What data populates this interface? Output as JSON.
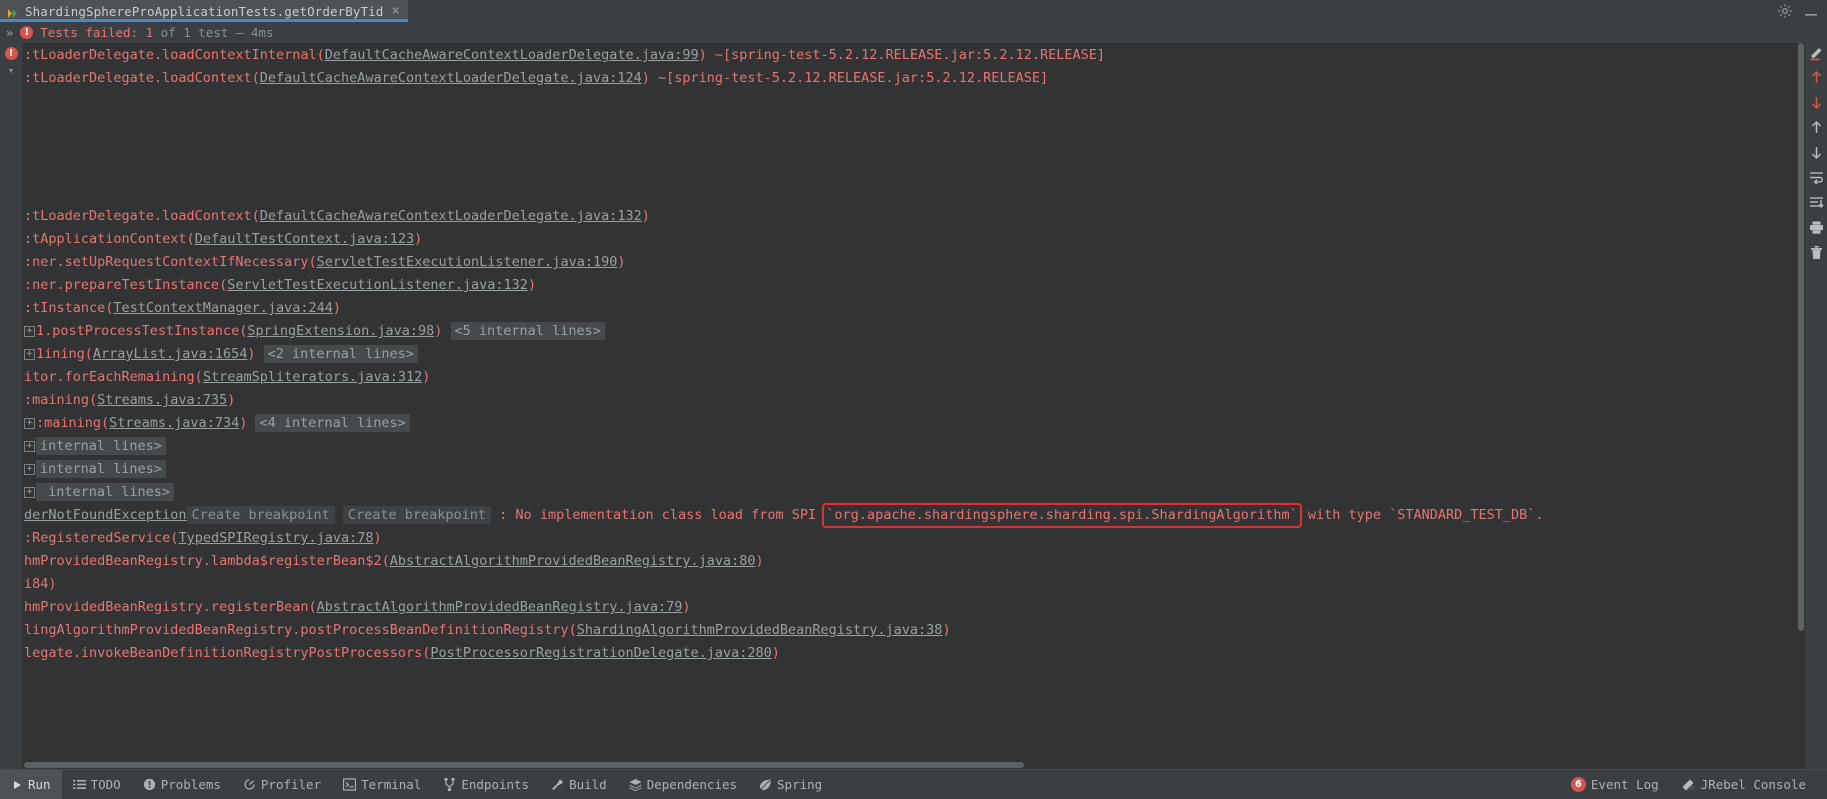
{
  "tab": {
    "label": "ShardingSphereProApplicationTests.getOrderByTid",
    "close": "×",
    "run_icon": "run-play-icon"
  },
  "titlebar_right": {
    "settings_icon": "gear-icon",
    "minimize_icon": "minimize-icon"
  },
  "status": {
    "chevron": "»",
    "error_icon": "error-exclamation-icon",
    "failed_label": "Tests failed: ",
    "failed_count": "1",
    "of_label": " of 1 test – 4ms"
  },
  "gutter": {
    "error_icon": "error-exclamation-icon",
    "collapse_icon": "chevron-down-icon"
  },
  "console": {
    "lines": [
      {
        "type": "trace",
        "fold": false,
        "segs": [
          {
            "t": "red",
            "v": ":tLoaderDelegate.loadContextInternal("
          },
          {
            "t": "link",
            "v": "DefaultCacheAwareContextLoaderDelegate.java:99"
          },
          {
            "t": "red",
            "v": ") ~[spring-test-5.2.12.RELEASE.jar:5.2.12.RELEASE]"
          }
        ]
      },
      {
        "type": "trace",
        "fold": false,
        "segs": [
          {
            "t": "red",
            "v": ":tLoaderDelegate.loadContext("
          },
          {
            "t": "link",
            "v": "DefaultCacheAwareContextLoaderDelegate.java:124"
          },
          {
            "t": "red",
            "v": ") ~[spring-test-5.2.12.RELEASE.jar:5.2.12.RELEASE]"
          }
        ]
      },
      {
        "type": "blank",
        "fold": false,
        "segs": []
      },
      {
        "type": "blank",
        "fold": false,
        "segs": []
      },
      {
        "type": "blank",
        "fold": false,
        "segs": []
      },
      {
        "type": "blank",
        "fold": false,
        "segs": []
      },
      {
        "type": "blank",
        "fold": false,
        "segs": []
      },
      {
        "type": "trace",
        "fold": false,
        "segs": [
          {
            "t": "red",
            "v": ":tLoaderDelegate.loadContext("
          },
          {
            "t": "link",
            "v": "DefaultCacheAwareContextLoaderDelegate.java:132"
          },
          {
            "t": "red",
            "v": ")"
          }
        ]
      },
      {
        "type": "trace",
        "fold": false,
        "segs": [
          {
            "t": "red",
            "v": ":tApplicationContext("
          },
          {
            "t": "link",
            "v": "DefaultTestContext.java:123"
          },
          {
            "t": "red",
            "v": ")"
          }
        ]
      },
      {
        "type": "trace",
        "fold": false,
        "segs": [
          {
            "t": "red",
            "v": ":ner.setUpRequestContextIfNecessary("
          },
          {
            "t": "link",
            "v": "ServletTestExecutionListener.java:190"
          },
          {
            "t": "red",
            "v": ")"
          }
        ]
      },
      {
        "type": "trace",
        "fold": false,
        "segs": [
          {
            "t": "red",
            "v": ":ner.prepareTestInstance("
          },
          {
            "t": "link",
            "v": "ServletTestExecutionListener.java:132"
          },
          {
            "t": "red",
            "v": ")"
          }
        ]
      },
      {
        "type": "trace",
        "fold": false,
        "segs": [
          {
            "t": "red",
            "v": ":tInstance("
          },
          {
            "t": "link",
            "v": "TestContextManager.java:244"
          },
          {
            "t": "red",
            "v": ")"
          }
        ]
      },
      {
        "type": "trace",
        "fold": true,
        "segs": [
          {
            "t": "red",
            "v": "1.postProcessTestInstance("
          },
          {
            "t": "link",
            "v": "SpringExtension.java:98"
          },
          {
            "t": "red",
            "v": ") "
          },
          {
            "t": "badge",
            "v": "<5 internal lines>"
          }
        ]
      },
      {
        "type": "trace",
        "fold": true,
        "segs": [
          {
            "t": "red",
            "v": "1ining("
          },
          {
            "t": "link",
            "v": "ArrayList.java:1654"
          },
          {
            "t": "red",
            "v": ") "
          },
          {
            "t": "badge",
            "v": "<2 internal lines>"
          }
        ]
      },
      {
        "type": "trace",
        "fold": false,
        "segs": [
          {
            "t": "red",
            "v": "itor.forEachRemaining("
          },
          {
            "t": "link",
            "v": "StreamSpliterators.java:312"
          },
          {
            "t": "red",
            "v": ")"
          }
        ]
      },
      {
        "type": "trace",
        "fold": false,
        "segs": [
          {
            "t": "red",
            "v": ":maining("
          },
          {
            "t": "link",
            "v": "Streams.java:735"
          },
          {
            "t": "red",
            "v": ")"
          }
        ]
      },
      {
        "type": "trace",
        "fold": true,
        "segs": [
          {
            "t": "red",
            "v": ":maining("
          },
          {
            "t": "link",
            "v": "Streams.java:734"
          },
          {
            "t": "red",
            "v": ") "
          },
          {
            "t": "badge",
            "v": "<4 internal lines>"
          }
        ]
      },
      {
        "type": "trace",
        "fold": true,
        "segs": [
          {
            "t": "badge",
            "v": "internal lines>"
          }
        ]
      },
      {
        "type": "trace",
        "fold": true,
        "segs": [
          {
            "t": "badge",
            "v": "internal lines>"
          }
        ]
      },
      {
        "type": "trace",
        "fold": true,
        "segs": [
          {
            "t": "badge",
            "v": " internal lines>"
          }
        ]
      },
      {
        "type": "exception",
        "fold": false,
        "segs": [
          {
            "t": "link",
            "v": "derNotFoundException"
          },
          {
            "t": "chip",
            "v": "Create breakpoint"
          },
          {
            "t": "red",
            "v": " "
          },
          {
            "t": "chip",
            "v": "Create breakpoint"
          },
          {
            "t": "red",
            "v": " : No implementation class load from SPI "
          },
          {
            "t": "hl",
            "v": "`org.apache.shardingsphere.sharding.spi.ShardingAlgorithm`"
          },
          {
            "t": "red",
            "v": " with type `STANDARD_TEST_DB`."
          }
        ]
      },
      {
        "type": "trace",
        "fold": false,
        "segs": [
          {
            "t": "red",
            "v": ":RegisteredService("
          },
          {
            "t": "link",
            "v": "TypedSPIRegistry.java:78"
          },
          {
            "t": "red",
            "v": ")"
          }
        ]
      },
      {
        "type": "trace",
        "fold": false,
        "segs": [
          {
            "t": "red",
            "v": "hmProvidedBeanRegistry.lambda$registerBean$2("
          },
          {
            "t": "link",
            "v": "AbstractAlgorithmProvidedBeanRegistry.java:80"
          },
          {
            "t": "red",
            "v": ")"
          }
        ]
      },
      {
        "type": "trace",
        "fold": false,
        "segs": [
          {
            "t": "red",
            "v": "i84)"
          }
        ]
      },
      {
        "type": "trace",
        "fold": false,
        "segs": [
          {
            "t": "red",
            "v": "hmProvidedBeanRegistry.registerBean("
          },
          {
            "t": "link",
            "v": "AbstractAlgorithmProvidedBeanRegistry.java:79"
          },
          {
            "t": "red",
            "v": ")"
          }
        ]
      },
      {
        "type": "trace",
        "fold": false,
        "segs": [
          {
            "t": "red",
            "v": "lingAlgorithmProvidedBeanRegistry.postProcessBeanDefinitionRegistry("
          },
          {
            "t": "link",
            "v": "ShardingAlgorithmProvidedBeanRegistry.java:38"
          },
          {
            "t": "red",
            "v": ")"
          }
        ]
      },
      {
        "type": "trace",
        "fold": false,
        "segs": [
          {
            "t": "red",
            "v": "legate.invokeBeanDefinitionRegistryPostProcessors("
          },
          {
            "t": "link",
            "v": "PostProcessorRegistrationDelegate.java:280"
          },
          {
            "t": "red",
            "v": ")"
          }
        ]
      }
    ]
  },
  "right_toolbar": {
    "items": [
      {
        "icon": "soft-wrap-icon",
        "name": "soft-wrap-button"
      },
      {
        "icon": "arrow-up-red-icon",
        "name": "previous-problem-button"
      },
      {
        "icon": "arrow-down-red-icon",
        "name": "next-problem-button"
      },
      {
        "icon": "arrow-up-icon",
        "name": "scroll-up-button"
      },
      {
        "icon": "arrow-down-icon",
        "name": "scroll-down-button"
      },
      {
        "icon": "wrap-text-icon",
        "name": "use-soft-wraps-button"
      },
      {
        "icon": "scroll-to-end-icon",
        "name": "scroll-to-end-button"
      },
      {
        "icon": "print-icon",
        "name": "print-button"
      },
      {
        "icon": "trash-icon",
        "name": "clear-all-button"
      }
    ]
  },
  "bottom_bar": {
    "items": [
      {
        "label": "Run",
        "icon": "run-play-icon",
        "active": true
      },
      {
        "label": "TODO",
        "icon": "todo-list-icon",
        "active": false
      },
      {
        "label": "Problems",
        "icon": "problems-icon",
        "active": false
      },
      {
        "label": "Profiler",
        "icon": "profiler-icon",
        "active": false
      },
      {
        "label": "Terminal",
        "icon": "terminal-icon",
        "active": false
      },
      {
        "label": "Endpoints",
        "icon": "endpoints-icon",
        "active": false
      },
      {
        "label": "Build",
        "icon": "build-hammer-icon",
        "active": false
      },
      {
        "label": "Dependencies",
        "icon": "dependencies-icon",
        "active": false
      },
      {
        "label": "Spring",
        "icon": "spring-leaf-icon",
        "active": false
      }
    ],
    "right": {
      "event_log_count": "6",
      "event_log_label": "Event Log",
      "jrebel_label": "JRebel Console",
      "jrebel_icon": "jrebel-icon"
    }
  },
  "colors": {
    "bg_chrome": "#3c3f41",
    "bg_console": "#313335",
    "error_red": "#e8756f",
    "highlight_box": "#e03030",
    "link_grey": "#9aa0a2",
    "tab_accent": "#4a88c7"
  }
}
